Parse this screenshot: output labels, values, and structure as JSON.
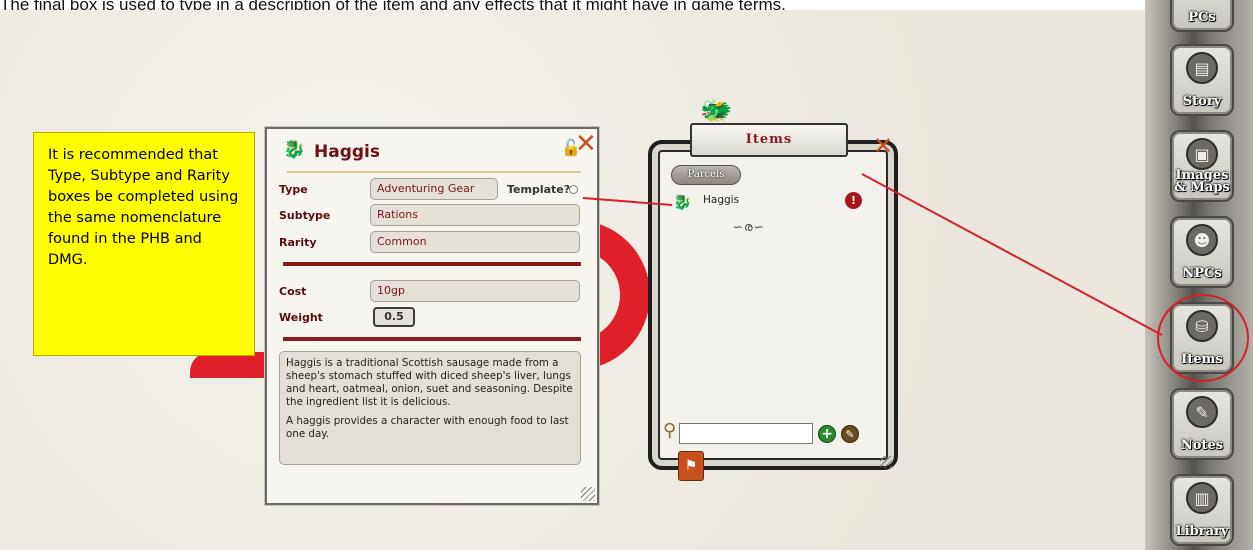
{
  "caption": "The final box is used to type in a description of the item and any effects that it might have in game terms.",
  "note": {
    "text": "It is recommended that Type, Subtype and Rarity boxes be completed using the same nomenclature found in the PHB and DMG."
  },
  "record": {
    "name": "Haggis",
    "icon": "haggis-icon",
    "lock_icon": "lock-icon",
    "close_glyph": "✕",
    "template_label": "Template?",
    "fields": {
      "type": {
        "label": "Type",
        "value": "Adventuring Gear"
      },
      "subtype": {
        "label": "Subtype",
        "value": "Rations"
      },
      "rarity": {
        "label": "Rarity",
        "value": "Common"
      },
      "cost": {
        "label": "Cost",
        "value": "10gp"
      },
      "weight": {
        "label": "Weight",
        "value": "0.5"
      }
    },
    "description": [
      "Haggis is a traditional Scottish sausage made from a sheep's stomach stuffed with diced sheep's liver, lungs and heart, oatmeal, onion, suet and seasoning. Despite the ingredient list it is delicious.",
      "A haggis provides a character with enough food to last one day."
    ]
  },
  "items_panel": {
    "title": "Items",
    "tab": "Parcels",
    "list": [
      {
        "name": "Haggis",
        "delete_glyph": "!"
      }
    ],
    "filter_value": "",
    "add_glyph": "+",
    "edit_glyph": "✎"
  },
  "sidebar": {
    "buttons": [
      {
        "label": "PCs",
        "icon": "pcs-icon"
      },
      {
        "label": "Story",
        "icon": "story-icon"
      },
      {
        "label": "Images & Maps",
        "icon": "images-maps-icon"
      },
      {
        "label": "NPCs",
        "icon": "npcs-icon"
      },
      {
        "label": "Items",
        "icon": "items-icon"
      },
      {
        "label": "Notes",
        "icon": "notes-icon"
      },
      {
        "label": "Library",
        "icon": "library-icon"
      }
    ]
  },
  "colors": {
    "note_bg": "#ffff00",
    "highlight": "#e02028",
    "accent": "#8a1a1e"
  }
}
